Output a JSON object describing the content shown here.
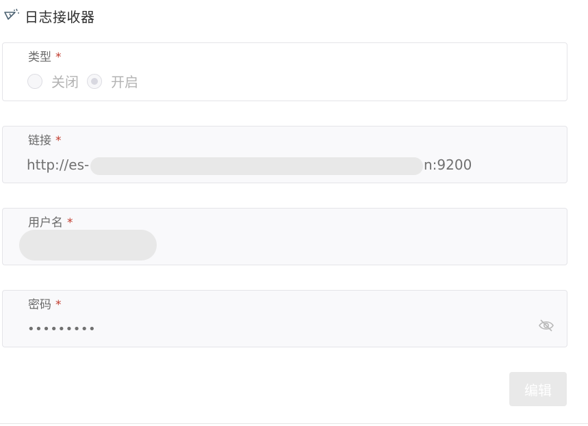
{
  "header": {
    "title": "日志接收器",
    "icon": "megaphone-sparkle-icon"
  },
  "type_field": {
    "label": "类型",
    "required_mark": "*",
    "options": [
      {
        "label": "关闭",
        "selected": false
      },
      {
        "label": "开启",
        "selected": true
      }
    ]
  },
  "link_field": {
    "label": "链接",
    "required_mark": "*",
    "value_prefix": "http://es-",
    "value_suffix": "n:9200"
  },
  "username_field": {
    "label": "用户名",
    "required_mark": "*"
  },
  "password_field": {
    "label": "密码",
    "required_mark": "*",
    "masked_value": "•••••••••",
    "toggle_icon": "eye-off-icon"
  },
  "actions": {
    "edit_label": "编辑"
  },
  "colors": {
    "required": "#c0392b",
    "disabled_button_bg": "#e9e9e9",
    "field_bg": "#f9f9fb",
    "field_border": "#e4e4e8"
  }
}
